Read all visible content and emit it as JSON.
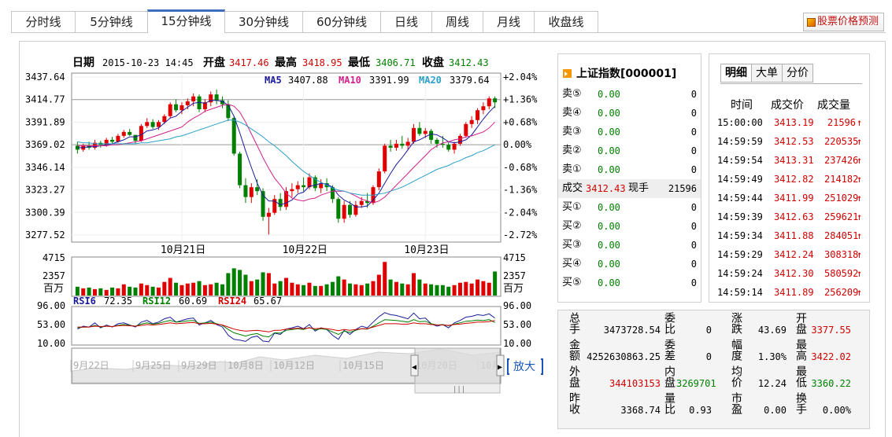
{
  "tabs": [
    "分时线",
    "5分钟线",
    "15分钟线",
    "30分钟线",
    "60分钟线",
    "日线",
    "周线",
    "月线",
    "收盘线"
  ],
  "active_tab": "15分钟线",
  "predict_label": "股票价格预测",
  "info": {
    "date_label": "日期",
    "date": "2015-10-23 14:45",
    "open_label": "开盘",
    "open": "3417.46",
    "high_label": "最高",
    "high": "3418.95",
    "low_label": "最低",
    "low": "3406.71",
    "close_label": "收盘",
    "close": "3412.43"
  },
  "ma": {
    "ma5_label": "MA5",
    "ma5": "3407.88",
    "ma10_label": "MA10",
    "ma10": "3391.99",
    "ma20_label": "MA20",
    "ma20": "3379.64"
  },
  "price_axis": [
    "3437.64",
    "3414.77",
    "3391.89",
    "3369.02",
    "3346.14",
    "3323.27",
    "3300.39",
    "3277.52"
  ],
  "pct_axis": [
    "+2.04%",
    "+1.36%",
    "+0.68%",
    "0.00%",
    "-0.68%",
    "-1.36%",
    "-2.04%",
    "-2.72%"
  ],
  "date_axis": [
    "10月21日",
    "10月22日",
    "10月23日"
  ],
  "vol_axis": {
    "top": "4715",
    "mid": "2357",
    "unit": "百万"
  },
  "rsi": {
    "rsi6_label": "RSI6",
    "rsi6": "72.35",
    "rsi12_label": "RSI12",
    "rsi12": "60.69",
    "rsi24_label": "RSI24",
    "rsi24": "65.67",
    "axis": [
      "96.00",
      "53.00",
      "10.00"
    ]
  },
  "nav_dates": [
    "9月22日",
    "9月25日",
    "9月29日",
    "10月8日",
    "10月12日",
    "10月15日",
    "10月20日",
    "10月"
  ],
  "zoom_label": "放大",
  "quote": {
    "title": "上证指数[000001]",
    "asks": [
      {
        "k": "卖⑤",
        "p": "0.00",
        "v": "0"
      },
      {
        "k": "卖④",
        "p": "0.00",
        "v": "0"
      },
      {
        "k": "卖③",
        "p": "0.00",
        "v": "0"
      },
      {
        "k": "卖②",
        "p": "0.00",
        "v": "0"
      },
      {
        "k": "卖①",
        "p": "0.00",
        "v": "0"
      }
    ],
    "deal": {
      "k": "成交",
      "p": "3412.43",
      "k2": "现手",
      "v": "21596"
    },
    "bids": [
      {
        "k": "买①",
        "p": "0.00",
        "v": "0"
      },
      {
        "k": "买②",
        "p": "0.00",
        "v": "0"
      },
      {
        "k": "买③",
        "p": "0.00",
        "v": "0"
      },
      {
        "k": "买④",
        "p": "0.00",
        "v": "0"
      },
      {
        "k": "买⑤",
        "p": "0.00",
        "v": "0"
      }
    ]
  },
  "trades": {
    "tabs": [
      "明细",
      "大单",
      "分价"
    ],
    "headers": [
      "时间",
      "成交价",
      "成交量"
    ],
    "rows": [
      {
        "t": "15:00:00",
        "p": "3413.19",
        "v": "21596"
      },
      {
        "t": "14:59:59",
        "p": "3412.53",
        "v": "220535"
      },
      {
        "t": "14:59:54",
        "p": "3413.31",
        "v": "237426"
      },
      {
        "t": "14:59:49",
        "p": "3412.82",
        "v": "214182"
      },
      {
        "t": "14:59:44",
        "p": "3411.99",
        "v": "251029"
      },
      {
        "t": "14:59:39",
        "p": "3412.63",
        "v": "259621"
      },
      {
        "t": "14:59:34",
        "p": "3411.88",
        "v": "284051"
      },
      {
        "t": "14:59:29",
        "p": "3412.24",
        "v": "308318"
      },
      {
        "t": "14:59:24",
        "p": "3412.30",
        "v": "580592"
      },
      {
        "t": "14:59:14",
        "p": "3411.89",
        "v": "256209"
      }
    ],
    "arrow": "↑"
  },
  "stats": [
    {
      "k": "总手",
      "v": "3473728.54",
      "c": "n"
    },
    {
      "k": "委比",
      "v": "0",
      "c": "n"
    },
    {
      "k": "涨跌",
      "v": "43.69",
      "c": "n"
    },
    {
      "k": "开盘",
      "v": "3377.55",
      "c": "r"
    },
    {
      "k": "金额",
      "v": "4252630863.25",
      "c": "n"
    },
    {
      "k": "委差",
      "v": "0",
      "c": "n"
    },
    {
      "k": "幅度",
      "v": "1.30%",
      "c": "n"
    },
    {
      "k": "最高",
      "v": "3422.02",
      "c": "r"
    },
    {
      "k": "外盘",
      "v": "344103153",
      "c": "r"
    },
    {
      "k": "内盘",
      "v": "3269701",
      "c": "g"
    },
    {
      "k": "均价",
      "v": "12.24",
      "c": "n"
    },
    {
      "k": "最低",
      "v": "3360.22",
      "c": "g"
    },
    {
      "k": "昨收",
      "v": "3368.74",
      "c": "n"
    },
    {
      "k": "量比",
      "v": "0.93",
      "c": "n"
    },
    {
      "k": "市盈",
      "v": "0.00",
      "c": "n"
    },
    {
      "k": "换手",
      "v": "0.00%",
      "c": "n"
    }
  ],
  "chart_data": {
    "type": "candlestick",
    "interval": "15分钟",
    "ylim": [
      3277.52,
      3437.64
    ],
    "up_color": "#e00000",
    "down_color": "#008000",
    "ma_colors": {
      "MA5": "#1a1a9c",
      "MA10": "#d4208a",
      "MA20": "#2aa0c8"
    },
    "ohlc": [
      [
        3368,
        3372,
        3360,
        3364
      ],
      [
        3364,
        3370,
        3362,
        3368
      ],
      [
        3368,
        3372,
        3364,
        3366
      ],
      [
        3366,
        3374,
        3364,
        3371
      ],
      [
        3371,
        3373,
        3366,
        3369
      ],
      [
        3369,
        3376,
        3367,
        3374
      ],
      [
        3374,
        3377,
        3370,
        3372
      ],
      [
        3372,
        3380,
        3371,
        3378
      ],
      [
        3378,
        3384,
        3376,
        3382
      ],
      [
        3382,
        3385,
        3378,
        3379
      ],
      [
        3379,
        3378,
        3370,
        3373
      ],
      [
        3373,
        3390,
        3372,
        3388
      ],
      [
        3388,
        3396,
        3386,
        3392
      ],
      [
        3392,
        3395,
        3385,
        3387
      ],
      [
        3387,
        3394,
        3384,
        3392
      ],
      [
        3392,
        3400,
        3390,
        3398
      ],
      [
        3398,
        3412,
        3396,
        3410
      ],
      [
        3410,
        3415,
        3402,
        3404
      ],
      [
        3404,
        3412,
        3400,
        3409
      ],
      [
        3409,
        3416,
        3405,
        3413
      ],
      [
        3413,
        3421,
        3408,
        3418
      ],
      [
        3418,
        3420,
        3402,
        3405
      ],
      [
        3405,
        3415,
        3402,
        3412
      ],
      [
        3412,
        3423,
        3408,
        3420
      ],
      [
        3420,
        3425,
        3410,
        3414
      ],
      [
        3414,
        3418,
        3406,
        3410
      ],
      [
        3410,
        3414,
        3393,
        3396
      ],
      [
        3396,
        3398,
        3358,
        3360
      ],
      [
        3360,
        3362,
        3325,
        3328
      ],
      [
        3328,
        3335,
        3310,
        3316
      ],
      [
        3316,
        3330,
        3310,
        3326
      ],
      [
        3326,
        3334,
        3318,
        3322
      ],
      [
        3322,
        3325,
        3292,
        3296
      ],
      [
        3296,
        3305,
        3278,
        3300
      ],
      [
        3300,
        3318,
        3298,
        3314
      ],
      [
        3314,
        3320,
        3302,
        3306
      ],
      [
        3306,
        3326,
        3303,
        3322
      ],
      [
        3322,
        3330,
        3316,
        3324
      ],
      [
        3324,
        3332,
        3320,
        3328
      ],
      [
        3328,
        3336,
        3322,
        3326
      ],
      [
        3326,
        3340,
        3324,
        3336
      ],
      [
        3336,
        3338,
        3322,
        3325
      ],
      [
        3325,
        3334,
        3320,
        3330
      ],
      [
        3330,
        3335,
        3322,
        3326
      ],
      [
        3326,
        3328,
        3310,
        3314
      ],
      [
        3314,
        3316,
        3290,
        3294
      ],
      [
        3294,
        3312,
        3290,
        3308
      ],
      [
        3308,
        3312,
        3295,
        3298
      ],
      [
        3298,
        3312,
        3296,
        3308
      ],
      [
        3308,
        3316,
        3305,
        3312
      ],
      [
        3312,
        3320,
        3305,
        3310
      ],
      [
        3310,
        3328,
        3308,
        3326
      ],
      [
        3326,
        3345,
        3323,
        3342
      ],
      [
        3342,
        3370,
        3340,
        3368
      ],
      [
        3368,
        3374,
        3362,
        3366
      ],
      [
        3366,
        3374,
        3363,
        3370
      ],
      [
        3370,
        3378,
        3365,
        3368
      ],
      [
        3368,
        3376,
        3364,
        3372
      ],
      [
        3372,
        3390,
        3370,
        3386
      ],
      [
        3386,
        3392,
        3378,
        3380
      ],
      [
        3380,
        3386,
        3376,
        3383
      ],
      [
        3383,
        3385,
        3370,
        3374
      ],
      [
        3374,
        3376,
        3366,
        3370
      ],
      [
        3370,
        3378,
        3366,
        3369
      ],
      [
        3369,
        3372,
        3362,
        3364
      ],
      [
        3364,
        3372,
        3360,
        3370
      ],
      [
        3370,
        3380,
        3368,
        3378
      ],
      [
        3378,
        3392,
        3376,
        3390
      ],
      [
        3390,
        3398,
        3386,
        3394
      ],
      [
        3394,
        3406,
        3390,
        3404
      ],
      [
        3404,
        3412,
        3400,
        3408
      ],
      [
        3408,
        3418,
        3405,
        3416
      ],
      [
        3416,
        3418,
        3406,
        3412
      ]
    ],
    "ma5": [
      3366,
      3366,
      3367,
      3367,
      3368,
      3369,
      3370,
      3372,
      3374,
      3377,
      3377,
      3379,
      3383,
      3384,
      3386,
      3391,
      3396,
      3398,
      3403,
      3407,
      3411,
      3412,
      3411,
      3414,
      3414,
      3413,
      3409,
      3398,
      3381,
      3363,
      3346,
      3330,
      3318,
      3312,
      3312,
      3308,
      3310,
      3313,
      3319,
      3321,
      3327,
      3328,
      3330,
      3329,
      3326,
      3318,
      3313,
      3310,
      3306,
      3306,
      3307,
      3313,
      3320,
      3330,
      3340,
      3349,
      3356,
      3364,
      3372,
      3374,
      3377,
      3380,
      3379,
      3376,
      3372,
      3371,
      3372,
      3374,
      3379,
      3387,
      3395,
      3402,
      3408
    ],
    "ma10": [
      3368,
      3368,
      3368,
      3368,
      3368,
      3368,
      3369,
      3369,
      3370,
      3371,
      3372,
      3373,
      3375,
      3377,
      3379,
      3381,
      3383,
      3385,
      3387,
      3392,
      3396,
      3399,
      3403,
      3405,
      3407,
      3409,
      3410,
      3408,
      3402,
      3392,
      3380,
      3368,
      3356,
      3345,
      3335,
      3328,
      3320,
      3315,
      3313,
      3312,
      3314,
      3315,
      3318,
      3320,
      3322,
      3322,
      3322,
      3320,
      3317,
      3314,
      3312,
      3310,
      3312,
      3316,
      3322,
      3328,
      3334,
      3340,
      3346,
      3352,
      3358,
      3364,
      3368,
      3371,
      3372,
      3374,
      3375,
      3377,
      3378,
      3380,
      3382,
      3386,
      3392
    ],
    "ma20": [
      3372,
      3371,
      3371,
      3370,
      3370,
      3370,
      3370,
      3370,
      3370,
      3370,
      3370,
      3371,
      3371,
      3372,
      3373,
      3374,
      3375,
      3377,
      3378,
      3380,
      3382,
      3384,
      3386,
      3388,
      3390,
      3392,
      3394,
      3394,
      3392,
      3389,
      3385,
      3381,
      3377,
      3372,
      3368,
      3363,
      3358,
      3352,
      3347,
      3342,
      3338,
      3334,
      3331,
      3328,
      3325,
      3323,
      3322,
      3320,
      3319,
      3318,
      3318,
      3318,
      3319,
      3320,
      3322,
      3324,
      3326,
      3329,
      3332,
      3335,
      3338,
      3341,
      3344,
      3346,
      3348,
      3351,
      3353,
      3356,
      3358,
      3361,
      3363,
      3366,
      3369
    ],
    "volume": [
      1100,
      900,
      1000,
      800,
      900,
      700,
      1000,
      900,
      1400,
      1100,
      1000,
      1500,
      1300,
      1100,
      1000,
      1700,
      2200,
      1600,
      1300,
      1500,
      1600,
      1800,
      1300,
      1400,
      1600,
      1400,
      2800,
      3400,
      3200,
      2600,
      1800,
      2000,
      2900,
      2800,
      1500,
      1800,
      2200,
      1600,
      1400,
      1300,
      1600,
      1200,
      1200,
      1400,
      1700,
      2400,
      2000,
      1500,
      1400,
      1300,
      1500,
      1800,
      2600,
      4200,
      2000,
      1700,
      1500,
      1400,
      2800,
      2000,
      1500,
      1400,
      1300,
      1300,
      1100,
      1300,
      1600,
      1700,
      1500,
      2000,
      1800,
      1600,
      3000
    ],
    "rsi6": [
      45,
      52,
      50,
      60,
      48,
      55,
      50,
      58,
      60,
      55,
      50,
      62,
      66,
      58,
      62,
      70,
      74,
      62,
      66,
      70,
      72,
      55,
      60,
      66,
      56,
      50,
      30,
      20,
      18,
      15,
      25,
      28,
      16,
      14,
      35,
      32,
      45,
      48,
      52,
      46,
      56,
      40,
      48,
      44,
      30,
      20,
      42,
      32,
      44,
      52,
      48,
      62,
      75,
      85,
      80,
      78,
      74,
      70,
      84,
      70,
      72,
      58,
      52,
      56,
      48,
      60,
      66,
      74,
      76,
      80,
      78,
      82,
      72
    ],
    "rsi12": [
      48,
      50,
      50,
      54,
      50,
      52,
      51,
      54,
      56,
      54,
      52,
      57,
      60,
      57,
      59,
      63,
      66,
      62,
      63,
      65,
      66,
      59,
      60,
      62,
      58,
      54,
      44,
      36,
      32,
      28,
      32,
      34,
      28,
      26,
      36,
      35,
      42,
      44,
      46,
      44,
      49,
      43,
      46,
      44,
      38,
      32,
      40,
      37,
      42,
      46,
      45,
      52,
      60,
      68,
      67,
      66,
      64,
      62,
      68,
      63,
      64,
      58,
      55,
      56,
      53,
      57,
      60,
      64,
      65,
      67,
      66,
      68,
      61
    ],
    "rsi24": [
      50,
      50,
      50,
      52,
      51,
      52,
      51,
      53,
      54,
      53,
      52,
      54,
      56,
      55,
      56,
      58,
      60,
      58,
      59,
      60,
      61,
      58,
      58,
      59,
      57,
      55,
      50,
      45,
      42,
      40,
      41,
      42,
      40,
      38,
      42,
      42,
      45,
      46,
      47,
      46,
      48,
      46,
      47,
      46,
      44,
      41,
      44,
      42,
      44,
      46,
      46,
      50,
      54,
      58,
      58,
      58,
      57,
      57,
      60,
      58,
      58,
      56,
      55,
      55,
      54,
      56,
      57,
      59,
      60,
      62,
      62,
      63,
      66
    ]
  }
}
